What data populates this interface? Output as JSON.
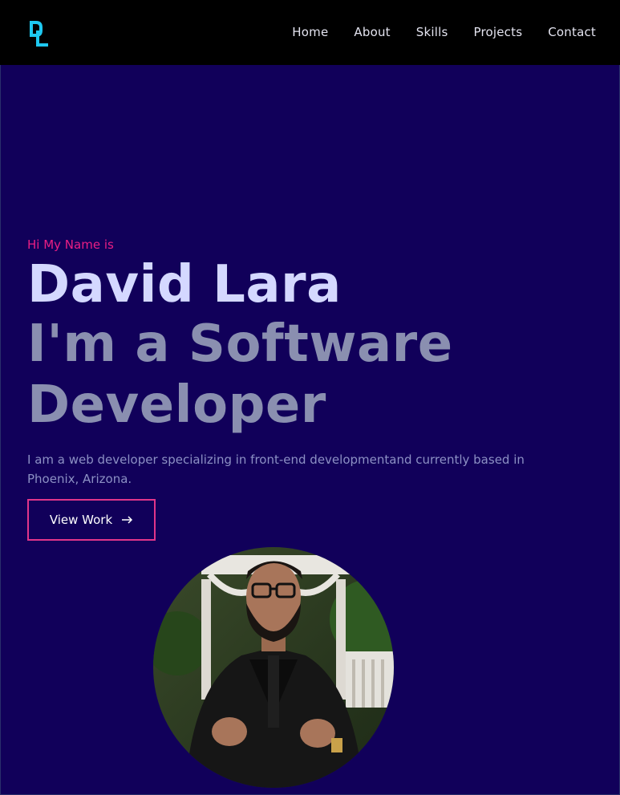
{
  "brand": {
    "logo_text": "DL"
  },
  "nav": {
    "items": [
      "Home",
      "About",
      "Skills",
      "Projects",
      "Contact"
    ]
  },
  "hero": {
    "greeting": "Hi My Name is",
    "name": "David Lara",
    "role_line1": "I'm a Software",
    "role_line2": "Developer",
    "bio": "I am a web developer specializing in front-end developmentand currently based in Phoenix, Arizona.",
    "cta_label": "View Work",
    "cta_icon": "arrow-right-icon"
  },
  "colors": {
    "background": "#11005a",
    "header": "#000000",
    "accent_pink": "#e91e84",
    "logo_cyan": "#1ec8f0",
    "name_color": "#d4d8ff",
    "role_color": "#8a8fb0"
  }
}
